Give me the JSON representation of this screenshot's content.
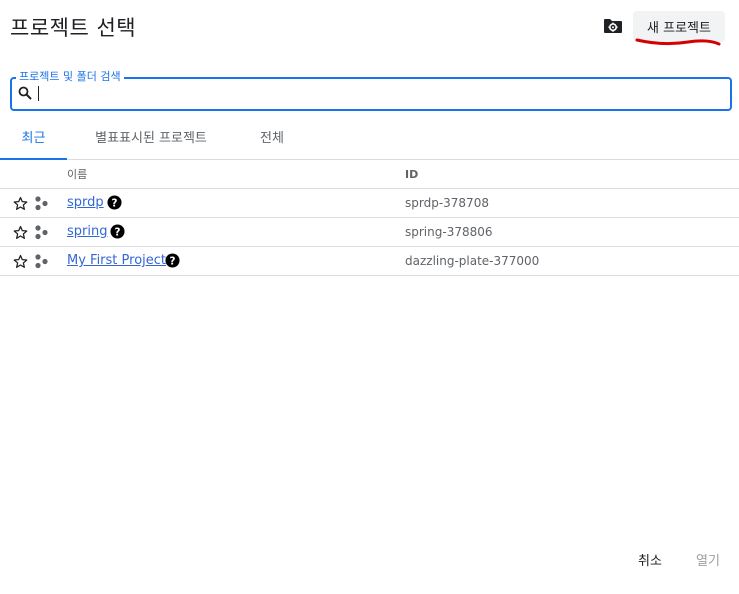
{
  "title": "프로젝트 선택",
  "header": {
    "folder_icon": "create-folder-icon",
    "new_project_label": "새 프로젝트",
    "annotation_color": "#d50000"
  },
  "search": {
    "label": "프로젝트 및 폴더 검색",
    "value": "",
    "icon": "search-icon"
  },
  "tabs": [
    {
      "label": "최근",
      "active": true
    },
    {
      "label": "별표표시된 프로젝트",
      "active": false
    },
    {
      "label": "전체",
      "active": false
    }
  ],
  "table": {
    "columns": {
      "name": "이름",
      "id": "ID"
    },
    "rows": [
      {
        "name": "sprdp",
        "id": "sprdp-378708"
      },
      {
        "name": "spring",
        "id": "spring-378806"
      },
      {
        "name": "My First Project",
        "id": "dazzling-plate-377000"
      }
    ]
  },
  "footer": {
    "cancel_label": "취소",
    "open_label": "열기"
  },
  "colors": {
    "accent": "#1a73e8",
    "link": "#3367d6",
    "divider": "#dadce0"
  }
}
